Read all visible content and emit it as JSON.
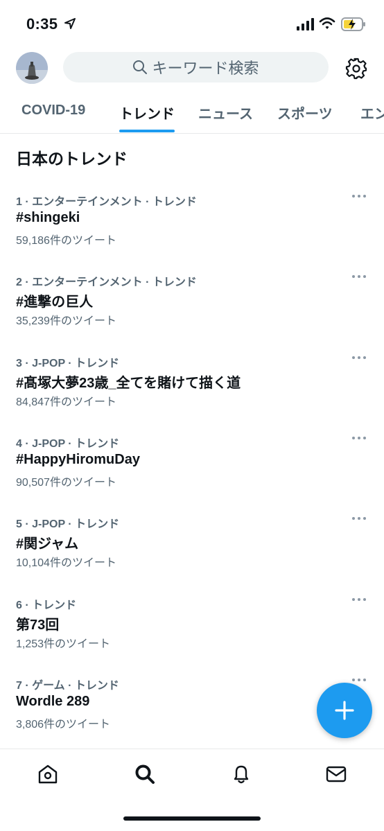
{
  "status_bar": {
    "time": "0:35"
  },
  "header": {
    "search_placeholder": "キーワード検索"
  },
  "tabs": [
    {
      "label": "COVID-19",
      "active": false
    },
    {
      "label": "トレンド",
      "active": true
    },
    {
      "label": "ニュース",
      "active": false
    },
    {
      "label": "スポーツ",
      "active": false
    },
    {
      "label": "エン",
      "active": false
    }
  ],
  "section_title": "日本のトレンド",
  "trends": [
    {
      "meta": "1 · エンターテインメント · トレンド",
      "title": "#shingeki",
      "count": "59,186件のツイート"
    },
    {
      "meta": "2 · エンターテインメント · トレンド",
      "title": "#進撃の巨人",
      "count": "35,239件のツイート"
    },
    {
      "meta": "3 · J-POP · トレンド",
      "title": "#髙塚大夢23歳_全てを賭けて描く道",
      "count": "84,847件のツイート"
    },
    {
      "meta": "4 · J-POP · トレンド",
      "title": "#HappyHiromuDay",
      "count": "90,507件のツイート"
    },
    {
      "meta": "5 · J-POP · トレンド",
      "title": "#関ジャム",
      "count": "10,104件のツイート"
    },
    {
      "meta": "6 · トレンド",
      "title": "第73回",
      "count": "1,253件のツイート"
    },
    {
      "meta": "7 · ゲーム · トレンド",
      "title": "Wordle 289",
      "count": "3,806件のツイート"
    }
  ],
  "colors": {
    "accent": "#1d9bf0",
    "text": "#0f1419",
    "secondary": "#536471"
  },
  "icons": {
    "location": "location-arrow-icon",
    "signal": "signal-icon",
    "wifi": "wifi-icon",
    "battery": "battery-charging-icon",
    "search": "search-icon",
    "settings": "gear-icon",
    "more": "more-icon",
    "compose": "plus-icon",
    "nav": [
      "home-icon",
      "search-icon",
      "bell-icon",
      "mail-icon"
    ]
  }
}
